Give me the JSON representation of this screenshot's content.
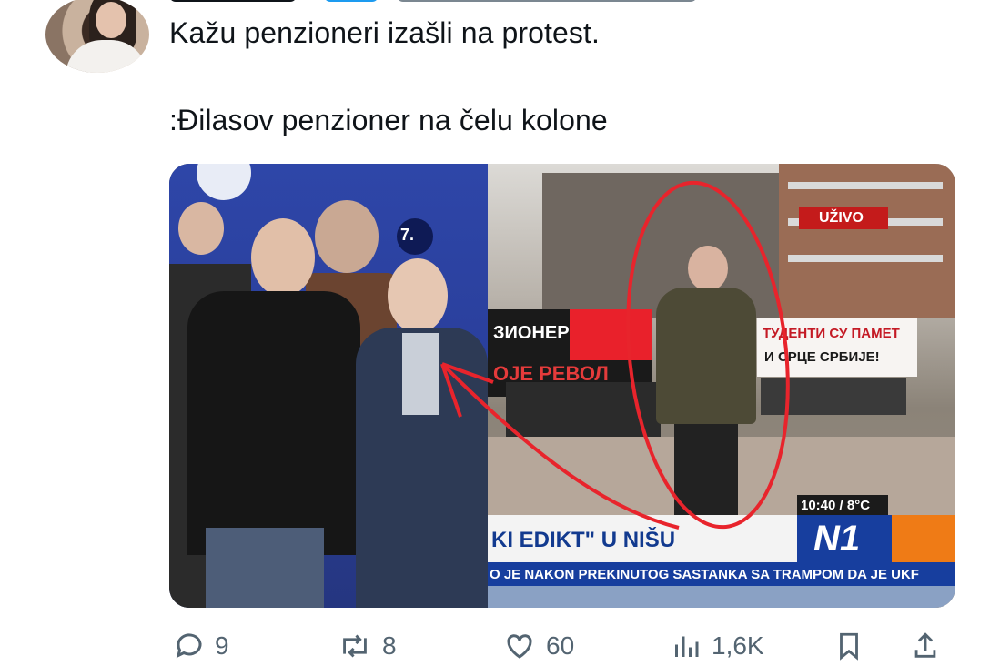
{
  "tweet": {
    "line1": "Kažu penzioneri izašli na protest.",
    "line2": ":Đilasov penzioner na čelu kolone"
  },
  "media": {
    "live_badge": "UŽIVO",
    "time_temp": "10:40 / 8°C",
    "channel_logo": "N1",
    "headline": "KI EDIKT\" U NIŠU",
    "ticker": "O JE NAKON PREKINUTOG SASTANKA SA TRAMPOM DA JE UKF",
    "banner_left_top": "ЗИОНЕРИ",
    "banner_left_bottom": "ОЈЕ РЕВОЛ",
    "banner_right_top": "ТУДЕНТИ СУ ПАМЕТ",
    "banner_right_bottom": "И СРЦЕ СРБИЈЕ!",
    "poster_left_number": "7.",
    "annotation_color": "#e8242c"
  },
  "actions": {
    "replies": "9",
    "reposts": "8",
    "likes": "60",
    "views": "1,6K"
  },
  "colors": {
    "text": "#0f1419",
    "muted": "#536471"
  }
}
